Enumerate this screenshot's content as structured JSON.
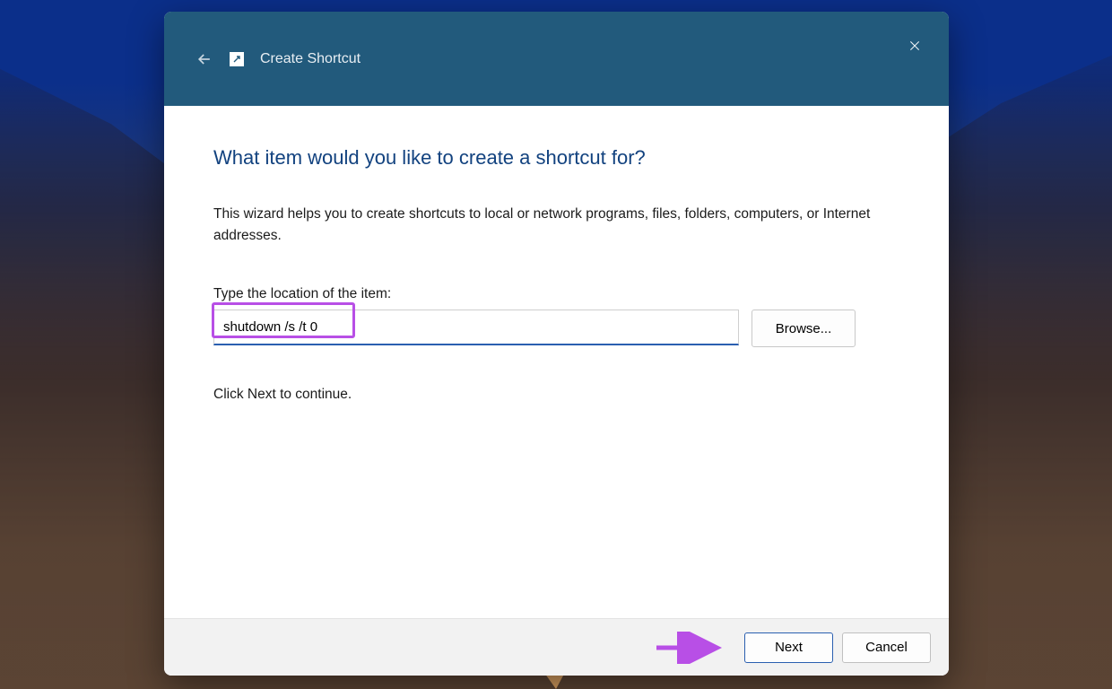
{
  "window": {
    "title": "Create Shortcut"
  },
  "content": {
    "headline": "What item would you like to create a shortcut for?",
    "description": "This wizard helps you to create shortcuts to local or network programs, files, folders, computers, or Internet addresses.",
    "location_label": "Type the location of the item:",
    "location_value": "shutdown /s /t 0",
    "browse_label": "Browse...",
    "continue_text": "Click Next to continue."
  },
  "footer": {
    "next_label": "Next",
    "cancel_label": "Cancel"
  },
  "annotations": {
    "highlight": "location-input",
    "arrow_target": "next-button",
    "arrow_color": "#b84fe6"
  }
}
